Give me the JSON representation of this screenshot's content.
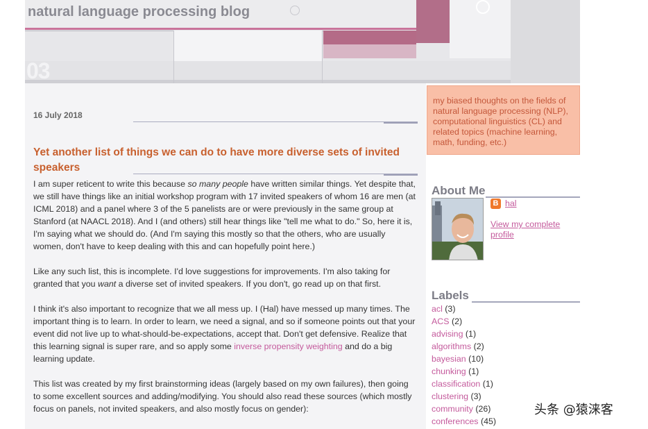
{
  "header": {
    "site_title": "natural language processing blog",
    "banner_number": "03"
  },
  "post": {
    "date": "16 July 2018",
    "title": "Yet another list of things we can do to have more diverse sets of invited speakers",
    "p1_a": "I am super reticent to write this because ",
    "p1_em": "so many people",
    "p1_b": " have written similar things. Yet despite that, we still have things like an initial workshop program with 17 invited speakers of whom 16 are men (at ICML 2018) and a panel where 3 of the 5 panelists are or were previously in the same group at Stanford (at NAACL 2018). And I (and others) still hear things like \"tell me what to do.\" So, here it is, I'm saying what we should do. (And I'm saying this mostly so that the others, who are usually women, don't have to keep dealing with this and can hopefully point here.)",
    "p2_a": "Like any such list, this is incomplete. I'd love suggestions for improvements. I'm also taking for granted that you ",
    "p2_em": "want",
    "p2_b": " a diverse set of invited speakers. If you don't, go read up on that first.",
    "p3_a": "I think it's also important to recognize that we all mess up. I (Hal) have messed up many times. The important thing is to learn. In order to learn, we need a signal, and so if someone points out that your event did not live up to what-should-be-expectations, accept that. Don't get defensive. Realize that this learning signal is super rare, and so apply some ",
    "p3_link": "inverse propensity weighting",
    "p3_b": " and do a big learning update.",
    "p4": "This list was created by my first brainstorming ideas (largely based on my own failures), then going to some excellent sources and adding/modifying. You should also read these sources (which mostly focus on panels, not invited speakers, and also mostly focus on gender):"
  },
  "sidebar": {
    "description": "my biased thoughts on the fields of natural language processing (NLP), computational linguistics (CL) and related topics (machine learning, math, funding, etc.)",
    "about_heading": "About Me",
    "profile_name": "hal",
    "profile_link": "View my complete profile",
    "labels_heading": "Labels",
    "labels": [
      {
        "name": "acl",
        "count": "(3)"
      },
      {
        "name": "ACS",
        "count": "(2)"
      },
      {
        "name": "advising",
        "count": "(1)"
      },
      {
        "name": "algorithms",
        "count": "(2)"
      },
      {
        "name": "bayesian",
        "count": "(10)"
      },
      {
        "name": "chunking",
        "count": "(1)"
      },
      {
        "name": "classification",
        "count": "(1)"
      },
      {
        "name": "clustering",
        "count": "(3)"
      },
      {
        "name": "community",
        "count": "(26)"
      },
      {
        "name": "conferences",
        "count": "(45)"
      }
    ]
  },
  "watermark": "头条 @猿涞客",
  "colors": {
    "title_orange": "#c8602e",
    "link_pink": "#c45a9c",
    "description_bg": "#f9bfa7"
  }
}
